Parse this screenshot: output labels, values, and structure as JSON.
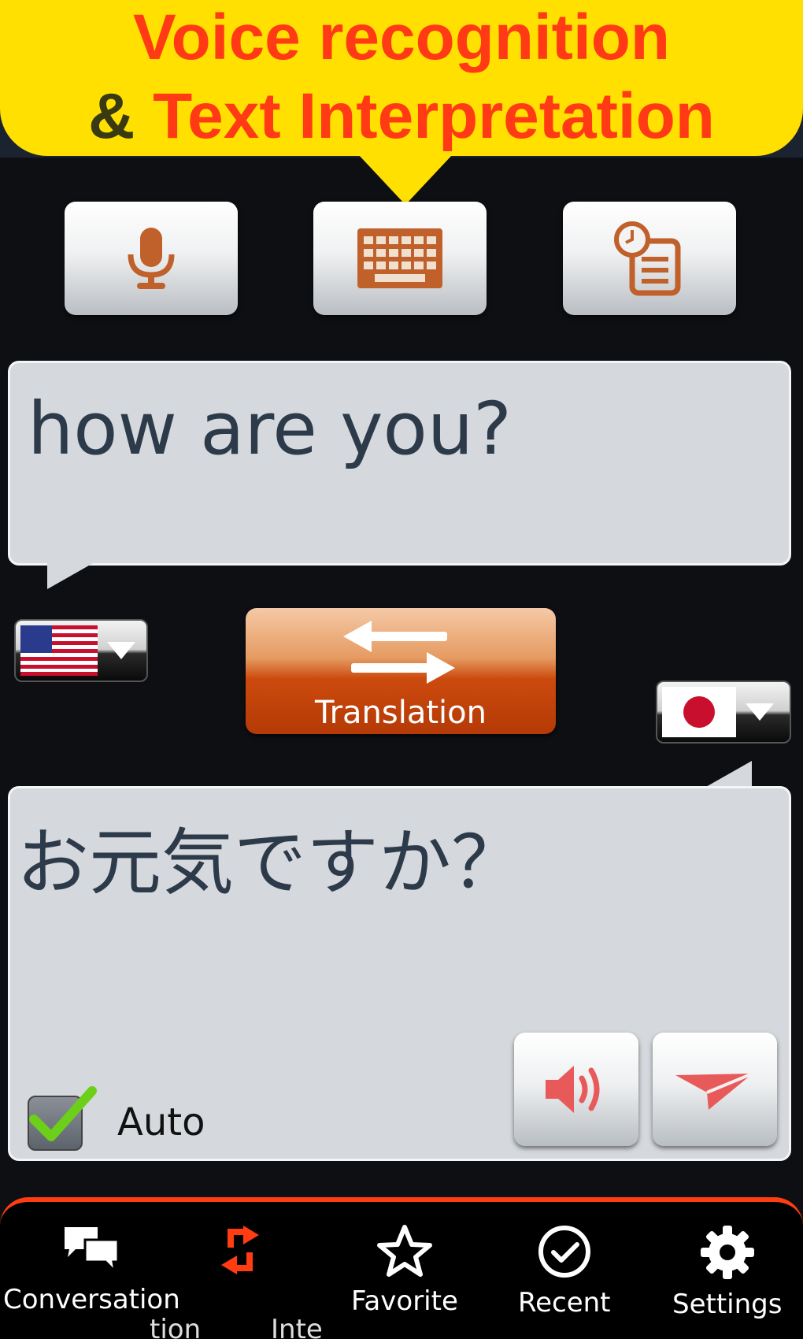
{
  "banner": {
    "line1": "Voice recognition",
    "line2_amp": "&",
    "line2_rest": " Text Interpretation"
  },
  "modes": [
    {
      "name": "voice",
      "icon": "microphone-icon"
    },
    {
      "name": "keyboard",
      "icon": "keyboard-icon",
      "selected": true
    },
    {
      "name": "history",
      "icon": "clipboard-history-icon"
    }
  ],
  "source": {
    "text": "how are you?",
    "language_flag": "us-flag-icon"
  },
  "translate": {
    "label": "Translation"
  },
  "target": {
    "text": "お元気ですか？",
    "language_flag": "japan-flag-icon",
    "auto_label": "Auto",
    "auto_checked": true
  },
  "nav": {
    "items": [
      {
        "label": "Conversation",
        "icon": "chat-bubbles-icon"
      },
      {
        "label": "Interpretation",
        "icon": "swap-arrows-icon",
        "active": true
      },
      {
        "label": "Favorite",
        "icon": "star-icon"
      },
      {
        "label": "Recent",
        "icon": "check-circle-icon"
      },
      {
        "label": "Settings",
        "icon": "gear-icon"
      }
    ],
    "ghost_a": "tion",
    "ghost_b": "Inte"
  },
  "colors": {
    "banner_bg": "#ffe000",
    "banner_text": "#ff3a14",
    "accent": "#ff3d10",
    "icon_brown": "#c0602a"
  }
}
